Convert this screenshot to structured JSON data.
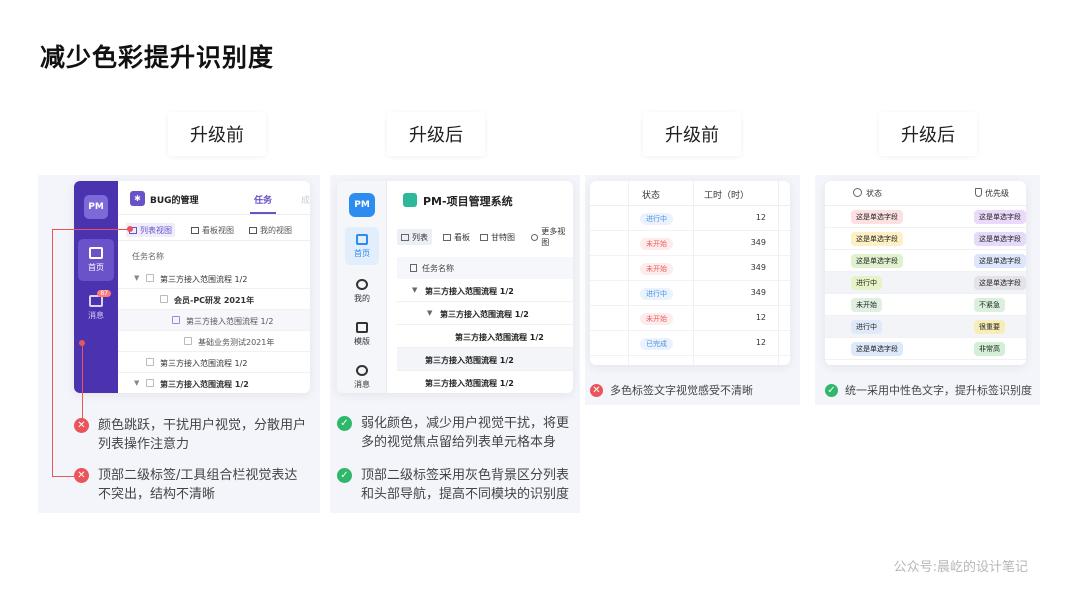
{
  "page_title": "减少色彩提升识别度",
  "labels": [
    "升级前",
    "升级后",
    "升级前",
    "升级后"
  ],
  "panel1": {
    "logo": "PM",
    "nav": [
      {
        "label": "首页"
      },
      {
        "label": "消息",
        "badge": "87"
      }
    ],
    "header_title": "BUG的管理",
    "header_tab": "任务",
    "header_tab2": "成",
    "views": [
      "列表视图",
      "看板视图",
      "我的视图"
    ],
    "table_header": "任务名称",
    "rows": [
      "第三方接入范围流程 1/2",
      "会员-PC研发 2021年",
      "第三方接入范围流程 1/2",
      "基础业务测试2021年",
      "第三方接入范围流程 1/2",
      "第三方接入范围流程 1/2"
    ],
    "notes": [
      "颜色跳跃，干扰用户视觉，分散用户\n列表操作注意力",
      "顶部二级标签/工具组合栏视觉表达\n不突出，结构不清晰"
    ]
  },
  "panel2": {
    "logo": "PM",
    "nav": [
      "首页",
      "我的",
      "模版",
      "消息"
    ],
    "header_title": "PM-项目管理系统",
    "tools": [
      "列表",
      "看板",
      "甘特图",
      "更多视图"
    ],
    "table_header": "任务名称",
    "rows": [
      "第三方接入范围流程 1/2",
      "第三方接入范围流程 1/2",
      "第三方接入范围流程 1/2",
      "第三方接入范围流程 1/2",
      "第三方接入范围流程 1/2"
    ],
    "notes": [
      "弱化颜色，减少用户视觉干扰，将更\n多的视觉焦点留给列表单元格本身",
      "顶部二级标签采用灰色背景区分列表\n和头部导航，提高不同模块的识别度"
    ]
  },
  "panel3": {
    "headers": [
      "状态",
      "工时（时）"
    ],
    "rows": [
      {
        "status": "进行中",
        "hours": "12",
        "color": "#4a90e2",
        "bg": "#eaf3fd"
      },
      {
        "status": "未开始",
        "hours": "349",
        "color": "#ee5c5c",
        "bg": "#fdecec"
      },
      {
        "status": "未开始",
        "hours": "349",
        "color": "#ee5c5c",
        "bg": "#fdecec"
      },
      {
        "status": "进行中",
        "hours": "349",
        "color": "#4a90e2",
        "bg": "#eaf3fd"
      },
      {
        "status": "未开始",
        "hours": "12",
        "color": "#ee5c5c",
        "bg": "#fdecec"
      },
      {
        "status": "已完成",
        "hours": "12",
        "color": "#4a90e2",
        "bg": "#eaf3fd"
      }
    ],
    "note": "多色标签文字视觉感受不清晰"
  },
  "panel4": {
    "headers": [
      "状态",
      "优先级"
    ],
    "rows": [
      {
        "status": "这是单选字段",
        "status_bg": "#fde0e2",
        "priority": "这是单选字段",
        "priority_bg": "#ead9fb"
      },
      {
        "status": "这是单选字段",
        "status_bg": "#fdf0c2",
        "priority": "这是单选字段",
        "priority_bg": "#e4daf9"
      },
      {
        "status": "这是单选字段",
        "status_bg": "#dff1cf",
        "priority": "这是单选字段",
        "priority_bg": "#dce7fb"
      },
      {
        "status": "进行中",
        "status_bg": "#e6f3c6",
        "priority": "这是单选字段",
        "priority_bg": "#e4e4e8"
      },
      {
        "status": "未开始",
        "status_bg": "#dff0e0",
        "priority": "不紧急",
        "priority_bg": "#d9f0dc"
      },
      {
        "status": "进行中",
        "status_bg": "#e0e9fa",
        "priority": "很重要",
        "priority_bg": "#f7edb8"
      },
      {
        "status": "这是单选字段",
        "status_bg": "#dde8fb",
        "priority": "非常高",
        "priority_bg": "#d3f0d6"
      }
    ],
    "note": "统一采用中性色文字，提升标签识别度"
  },
  "footer_credit": "公众号:晨屹的设计笔记",
  "colors": {
    "bad": "#e9555a",
    "good": "#2fb86a",
    "old_brand": "#4b33b0",
    "new_brand": "#2d8cf0"
  }
}
